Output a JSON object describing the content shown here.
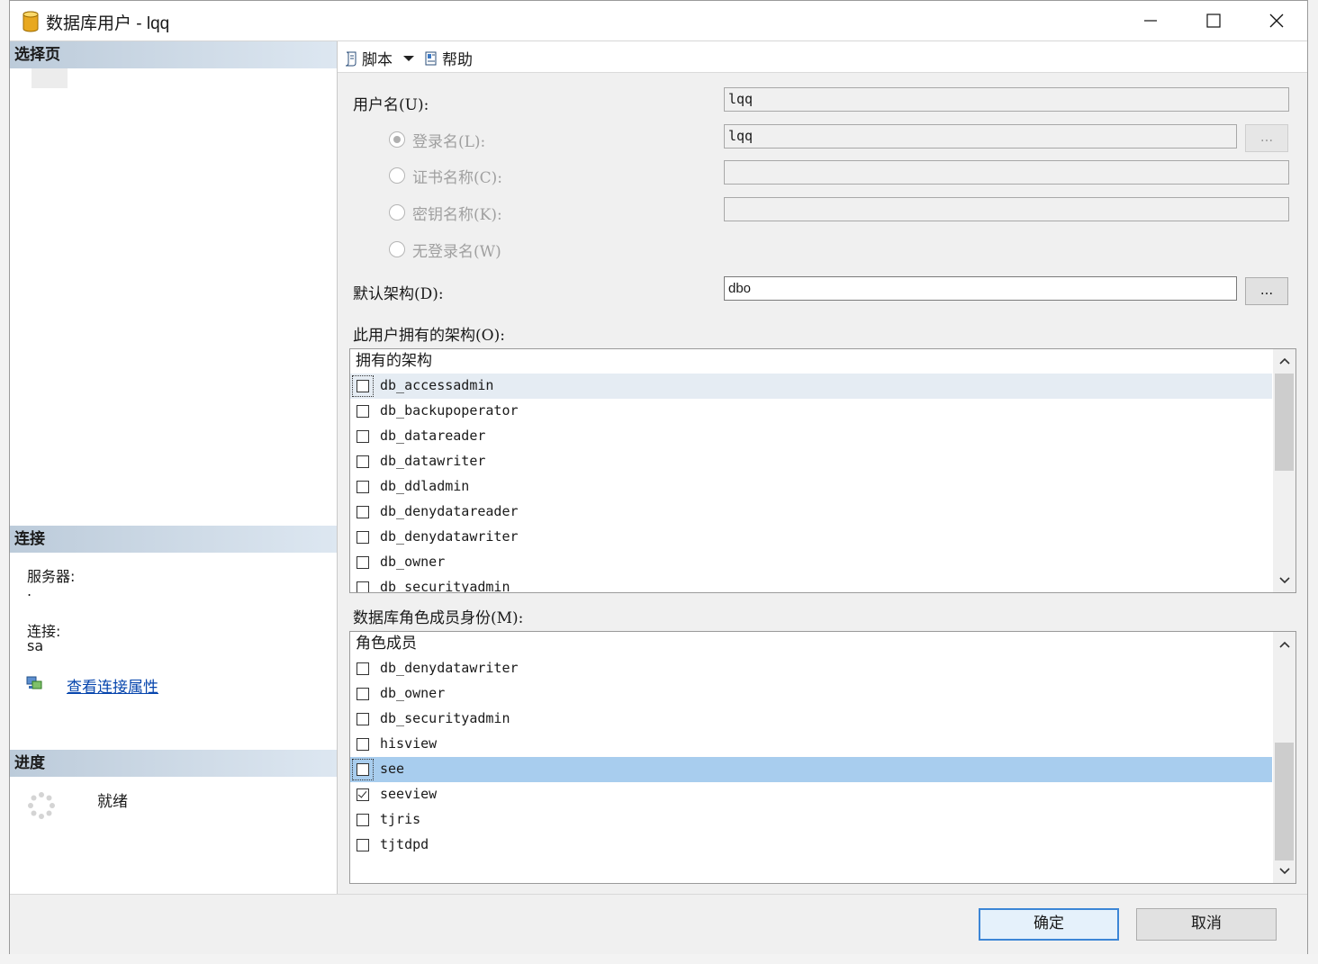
{
  "window": {
    "title": "数据库用户 - lqq"
  },
  "left_pane": {
    "select_page_header": "选择页",
    "connection_header": "连接",
    "server_label": "服务器:",
    "server_value": ".",
    "connection_label": "连接:",
    "connection_value": "sa",
    "view_connection_link": "查看连接属性",
    "progress_header": "进度",
    "progress_status": "就绪"
  },
  "toolbar": {
    "script_label": "脚本",
    "help_label": "帮助"
  },
  "form": {
    "username_label": "用户名(U):",
    "username_value": "lqq",
    "login_name_label": "登录名(L):",
    "login_name_value": "lqq",
    "cert_name_label": "证书名称(C):",
    "cert_name_value": "",
    "key_name_label": "密钥名称(K):",
    "key_name_value": "",
    "no_login_label": "无登录名(W)",
    "browse_label": "...",
    "default_schema_label": "默认架构(D):",
    "default_schema_value": "dbo"
  },
  "owned_schemas": {
    "label": "此用户拥有的架构(O):",
    "column_header": "拥有的架构",
    "items": [
      {
        "name": "db_accessadmin",
        "checked": false
      },
      {
        "name": "db_backupoperator",
        "checked": false
      },
      {
        "name": "db_datareader",
        "checked": false
      },
      {
        "name": "db_datawriter",
        "checked": false
      },
      {
        "name": "db_ddladmin",
        "checked": false
      },
      {
        "name": "db_denydatareader",
        "checked": false
      },
      {
        "name": "db_denydatawriter",
        "checked": false
      },
      {
        "name": "db_owner",
        "checked": false
      },
      {
        "name": "db_securityadmin",
        "checked": false
      }
    ]
  },
  "role_membership": {
    "label": "数据库角色成员身份(M):",
    "column_header": "角色成员",
    "items": [
      {
        "name": "db_denydatawriter",
        "checked": false
      },
      {
        "name": "db_owner",
        "checked": false
      },
      {
        "name": "db_securityadmin",
        "checked": false
      },
      {
        "name": "hisview",
        "checked": false
      },
      {
        "name": "see",
        "checked": false
      },
      {
        "name": "seeview",
        "checked": true
      },
      {
        "name": "tjris",
        "checked": false
      },
      {
        "name": "tjtdpd",
        "checked": false
      }
    ]
  },
  "buttons": {
    "ok_label": "确定",
    "cancel_label": "取消"
  }
}
